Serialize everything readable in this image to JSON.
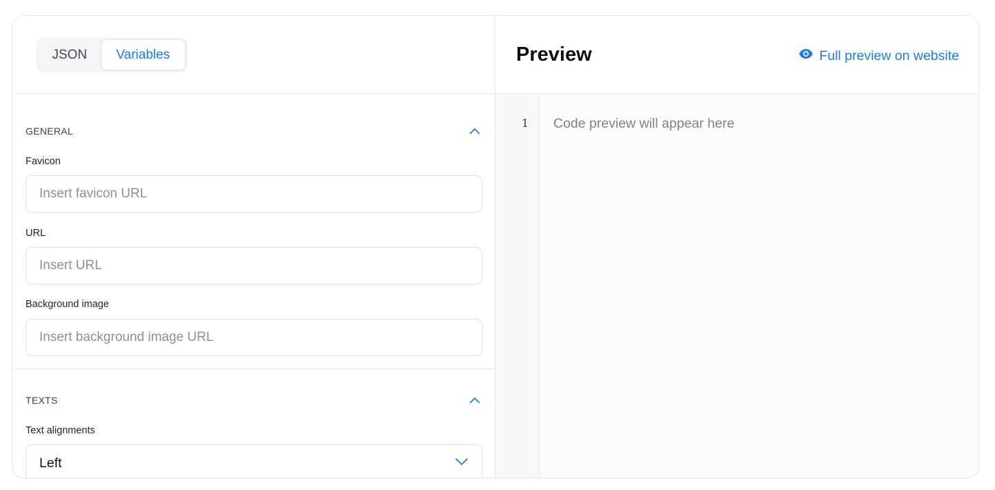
{
  "tabs": {
    "json_label": "JSON",
    "variables_label": "Variables",
    "active": "Variables"
  },
  "general": {
    "title": "GENERAL",
    "favicon": {
      "label": "Favicon",
      "placeholder": "Insert favicon URL",
      "value": ""
    },
    "url": {
      "label": "URL",
      "placeholder": "Insert URL",
      "value": ""
    },
    "background": {
      "label": "Background image",
      "placeholder": "Insert background image URL",
      "value": ""
    }
  },
  "texts": {
    "title": "TEXTS",
    "alignment": {
      "label": "Text alignments",
      "value": "Left"
    }
  },
  "preview": {
    "title": "Preview",
    "full_link": "Full preview on website",
    "line_number": "1",
    "placeholder": "Code preview will appear here"
  },
  "icons": {
    "collapse": "chevron-up-icon",
    "dropdown": "chevron-down-icon",
    "preview": "eye-icon"
  },
  "colors": {
    "accent": "#1a7ee6",
    "border": "#e6e8ec",
    "muted_text": "#8a9099"
  }
}
